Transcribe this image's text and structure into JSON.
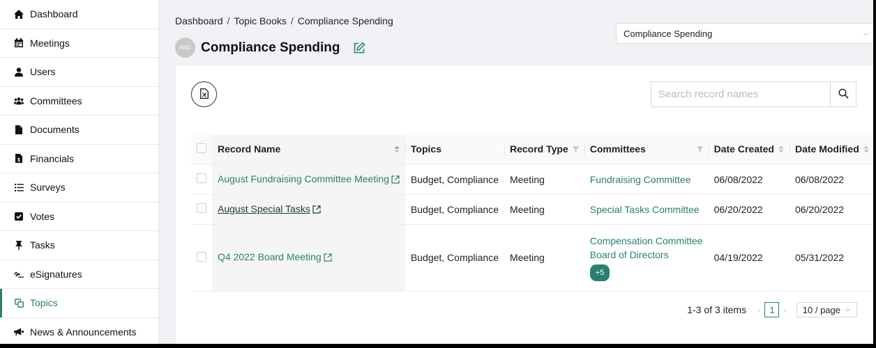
{
  "sidebar": {
    "items": [
      {
        "label": "Dashboard",
        "icon": "home-icon"
      },
      {
        "label": "Meetings",
        "icon": "calendar-icon"
      },
      {
        "label": "Users",
        "icon": "user-icon"
      },
      {
        "label": "Committees",
        "icon": "users-icon"
      },
      {
        "label": "Documents",
        "icon": "document-icon"
      },
      {
        "label": "Financials",
        "icon": "financial-document-icon"
      },
      {
        "label": "Surveys",
        "icon": "list-icon"
      },
      {
        "label": "Votes",
        "icon": "check-square-icon"
      },
      {
        "label": "Tasks",
        "icon": "pin-icon"
      },
      {
        "label": "eSignatures",
        "icon": "signature-icon"
      },
      {
        "label": "Topics",
        "icon": "topics-icon",
        "active": true
      },
      {
        "label": "News & Announcements",
        "icon": "megaphone-icon"
      }
    ]
  },
  "header": {
    "breadcrumb": [
      "Dashboard",
      "Topic Books",
      "Compliance Spending"
    ],
    "avatar_text": "AND",
    "title": "Compliance Spending",
    "topic_select_value": "Compliance Spending"
  },
  "toolbar": {
    "search_placeholder": "Search record names"
  },
  "table": {
    "columns": [
      "Record Name",
      "Topics",
      "Record Type",
      "Committees",
      "Date Created",
      "Date Modified"
    ],
    "rows": [
      {
        "name": "August Fundraising Committee Meeting",
        "topics": "Budget, Compliance",
        "type": "Meeting",
        "committees": [
          "Fundraising Committee"
        ],
        "more": "",
        "created": "06/08/2022",
        "modified": "06/08/2022"
      },
      {
        "name": "August Special Tasks",
        "topics": "Budget, Compliance",
        "type": "Meeting",
        "committees": [
          "Special Tasks Committee"
        ],
        "more": "",
        "created": "06/20/2022",
        "modified": "06/20/2022"
      },
      {
        "name": "Q4 2022 Board Meeting",
        "topics": "Budget, Compliance",
        "type": "Meeting",
        "committees": [
          "Compensation Committee",
          "Board of Directors"
        ],
        "more": "+5",
        "created": "04/19/2022",
        "modified": "05/31/2022"
      }
    ]
  },
  "pagination": {
    "summary": "1-3 of 3 items",
    "current_page": "1",
    "page_size": "10 / page"
  },
  "colors": {
    "accent": "#2a7f72",
    "background": "#f0f2f5"
  }
}
